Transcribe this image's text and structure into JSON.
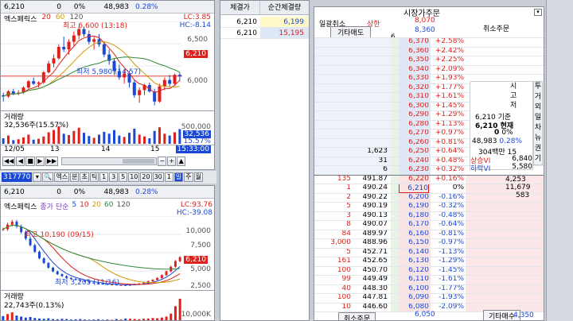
{
  "chart1": {
    "header": {
      "price": "6,210",
      "change": "0",
      "pct": "0%",
      "volume": "48,983",
      "vol_pct": "0.28%"
    },
    "legend": {
      "name": "엑스페릭스",
      "ma1": "20",
      "ma2": "60",
      "ma3": "120"
    },
    "high_label": "최고 6,600 (13:18)",
    "low_label": "최저 5,980 (14:57)",
    "lc_label": "LC:3.85",
    "hc_label": "HC:-8.14",
    "price_tag": "6,210",
    "y_ticks": [
      "6,500",
      "6,000"
    ],
    "vol_title": "거래량",
    "vol_value": "32,536주(15.57%)",
    "vol_ticks": [
      "500,000",
      "32,536",
      "15.57%",
      "0"
    ],
    "x_labels": [
      "12/05",
      "13",
      "14",
      "15",
      "15:33:00"
    ],
    "candles": [
      [
        6060,
        6080,
        6010,
        6050
      ],
      [
        6050,
        6100,
        6040,
        6090
      ],
      [
        6090,
        6110,
        6060,
        6070
      ],
      [
        6070,
        6100,
        6060,
        6080
      ],
      [
        6080,
        6130,
        6070,
        6120
      ],
      [
        6120,
        6180,
        6110,
        6170
      ],
      [
        6170,
        6200,
        6140,
        6150
      ],
      [
        6150,
        6170,
        6120,
        6160
      ],
      [
        6160,
        6250,
        6150,
        6240
      ],
      [
        6240,
        6330,
        6230,
        6310
      ],
      [
        6310,
        6380,
        6280,
        6350
      ],
      [
        6350,
        6460,
        6340,
        6440
      ],
      [
        6440,
        6520,
        6400,
        6420
      ],
      [
        6420,
        6500,
        6380,
        6480
      ],
      [
        6480,
        6560,
        6450,
        6530
      ],
      [
        6530,
        6600,
        6500,
        6580
      ],
      [
        6580,
        6600,
        6520,
        6540
      ],
      [
        6540,
        6570,
        6460,
        6480
      ],
      [
        6480,
        6520,
        6420,
        6500
      ],
      [
        6500,
        6540,
        6440,
        6460
      ],
      [
        6460,
        6480,
        6360,
        6380
      ],
      [
        6380,
        6420,
        6300,
        6330
      ],
      [
        6330,
        6350,
        6220,
        6250
      ],
      [
        6250,
        6300,
        6180,
        6200
      ],
      [
        6200,
        6260,
        6150,
        6230
      ],
      [
        6230,
        6250,
        6120,
        6160
      ],
      [
        6160,
        6180,
        6040,
        6060
      ],
      [
        6060,
        6120,
        6000,
        6100
      ],
      [
        6100,
        6150,
        6060,
        6140
      ],
      [
        6140,
        6160,
        6080,
        6090
      ],
      [
        6090,
        6110,
        5980,
        6010
      ],
      [
        6010,
        6150,
        6000,
        6130
      ],
      [
        6130,
        6200,
        6100,
        6180
      ],
      [
        6180,
        6220,
        6130,
        6150
      ],
      [
        6150,
        6230,
        6140,
        6220
      ],
      [
        6220,
        6240,
        6170,
        6210
      ]
    ],
    "vol_bars": [
      12,
      18,
      8,
      10,
      14,
      20,
      9,
      11,
      16,
      25,
      30,
      38,
      22,
      19,
      28,
      35,
      24,
      17,
      13,
      20,
      26,
      22,
      30,
      18,
      15,
      24,
      33,
      20,
      16,
      12,
      28,
      36,
      22,
      18,
      25,
      32
    ]
  },
  "toolbar": {
    "code": "317770",
    "name_btn": "엑스",
    "tf": [
      "분",
      "초",
      "틱",
      "1",
      "3",
      "5",
      "10",
      "20",
      "30",
      "1"
    ],
    "day": "일",
    "week": "주",
    "month": "월"
  },
  "chart2": {
    "header": {
      "price": "6,210",
      "change": "0",
      "pct": "0%",
      "volume": "48,983",
      "vol_pct": "0.28%"
    },
    "legend": {
      "name": "엑스페릭스",
      "mode": "종가 단순",
      "ma1": "5",
      "ma2": "10",
      "ma3": "20",
      "ma4": "60",
      "ma5": "120"
    },
    "high_label": "최고 10,190 (09/15)",
    "low_label": "최저 3,205 (11/16)",
    "lc_label": "LC:93.76",
    "hc_label": "HC:-39.08",
    "price_tag": "6,210",
    "y_ticks": [
      "10,000",
      "7,500",
      "5,000",
      "2,500"
    ],
    "vol_title": "거래량",
    "vol_value": "22,743주(0.13%)",
    "vol_tick": "10,000K",
    "closes": [
      9200,
      9700,
      10000,
      9500,
      8900,
      8200,
      7500,
      6800,
      6100,
      5600,
      5100,
      4700,
      4400,
      4200,
      4000,
      3900,
      3800,
      3700,
      3600,
      3500,
      3450,
      3400,
      3350,
      3300,
      3300,
      3250,
      3250,
      3205,
      3300,
      3350,
      3400,
      3500,
      3650,
      3800,
      4000,
      4300,
      4700,
      5200,
      5800,
      6210
    ],
    "vol_bars": [
      20,
      28,
      35,
      22,
      18,
      14,
      16,
      12,
      10,
      9,
      11,
      8,
      7,
      9,
      8,
      6,
      7,
      8,
      6,
      5,
      6,
      7,
      5,
      6,
      5,
      8,
      6,
      10,
      9,
      8,
      7,
      9,
      10,
      12,
      11,
      14,
      18,
      30,
      60,
      90
    ]
  },
  "execution": {
    "headers": [
      "체결가",
      "순간체결량"
    ],
    "rows": [
      {
        "price": "6,210",
        "qty": "6,199",
        "qcolor": "#1b49d6"
      },
      {
        "price": "6,210",
        "qty": "15,195",
        "qcolor": "#e0201b"
      }
    ]
  },
  "orderbook": {
    "title": "시장가주문",
    "buttons": {
      "cancel_all": "일괄취소",
      "upper": "상한",
      "other_sell": "기타매도",
      "other_buy": "기타매수",
      "cancel_order": "취소주문",
      "cancel_order2": "취소주문",
      "cancel_right": "취소주문"
    },
    "top_prices": [
      {
        "p": "8,070",
        "c": "r"
      },
      {
        "p": "8,360",
        "c": "b"
      }
    ],
    "top_qty": "6",
    "ask": [
      [
        "6,370",
        "+2.58%",
        ""
      ],
      [
        "6,360",
        "+2.42%",
        ""
      ],
      [
        "6,350",
        "+2.25%",
        ""
      ],
      [
        "6,340",
        "+2.09%",
        ""
      ],
      [
        "6,330",
        "+1.93%",
        ""
      ],
      [
        "6,320",
        "+1.77%",
        ""
      ],
      [
        "6,310",
        "+1.61%",
        ""
      ],
      [
        "6,300",
        "+1.45%",
        ""
      ],
      [
        "6,290",
        "+1.29%",
        ""
      ],
      [
        "6,280",
        "+1.13%",
        ""
      ],
      [
        "6,270",
        "+0.97%",
        ""
      ],
      [
        "6,260",
        "+0.81%",
        ""
      ],
      [
        "6,250",
        "+0.64%",
        "1,623"
      ],
      [
        "6,240",
        "+0.48%",
        "31"
      ],
      [
        "6,230",
        "+0.32%",
        "6"
      ]
    ],
    "bid": [
      [
        "6,220",
        "+0.16%",
        "135",
        "491.87"
      ],
      [
        "6,210",
        "0%",
        "1",
        "490.24"
      ],
      [
        "6,200",
        "-0.16%",
        "2",
        "490.22"
      ],
      [
        "6,190",
        "-0.32%",
        "5",
        "490.19"
      ],
      [
        "6,180",
        "-0.48%",
        "3",
        "490.13"
      ],
      [
        "6,170",
        "-0.64%",
        "8",
        "490.07"
      ],
      [
        "6,160",
        "-0.81%",
        "84",
        "489.97"
      ],
      [
        "6,150",
        "-0.97%",
        "3,000",
        "488.96"
      ],
      [
        "6,140",
        "-1.13%",
        "5",
        "452.71"
      ],
      [
        "6,130",
        "-1.29%",
        "161",
        "452.65"
      ],
      [
        "6,120",
        "-1.45%",
        "100",
        "450.70"
      ],
      [
        "6,110",
        "-1.61%",
        "99",
        "449.49"
      ],
      [
        "6,100",
        "-1.77%",
        "40",
        "448.30"
      ],
      [
        "6,090",
        "-1.93%",
        "100",
        "447.81"
      ],
      [
        "6,080",
        "-2.09%",
        "10",
        "446.60"
      ]
    ],
    "bottom_price": "6,050",
    "bottom_price2": "4,350"
  },
  "info": {
    "vert1": [
      "시",
      "고",
      "저"
    ],
    "vert2": [
      "투",
      "거",
      "외",
      "일",
      "차",
      "뉴",
      "권",
      "기"
    ],
    "base_price": "6,210",
    "base_label": "기준",
    "cur_price": "6,210",
    "cur_label": "현재",
    "zero": "0",
    "zero_pct": "0%",
    "vol": "48,983",
    "vol_pct": "0.28%",
    "amt": "304백만",
    "amt2": "15",
    "vi_up_label": "상승VI",
    "vi_up": "6,840",
    "vi_down_label": "하락VI",
    "vi_down": "5,580",
    "ask_total": "4,253",
    "bid_total": "11,679",
    "bid_sub": "583"
  }
}
